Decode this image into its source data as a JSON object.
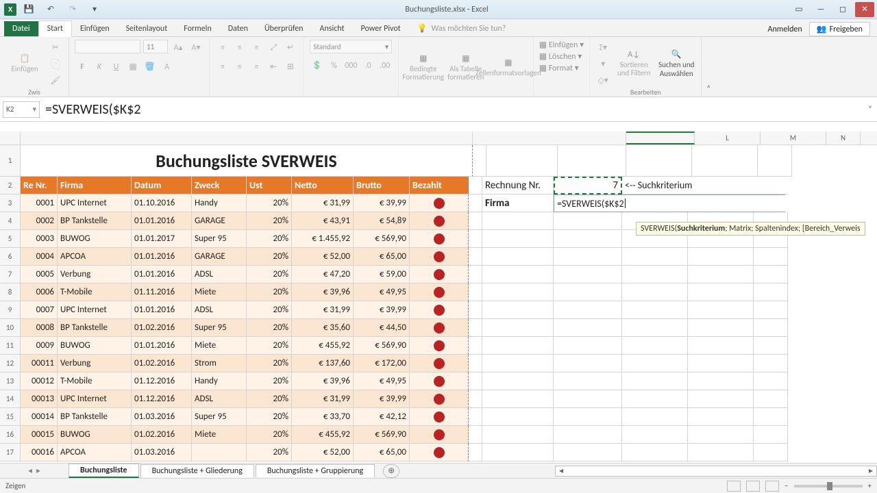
{
  "titlebar": {
    "title": "Buchungsliste.xlsx - Excel"
  },
  "tabs": {
    "file": "Datei",
    "start": "Start",
    "einfuegen": "Einfügen",
    "seitenlayout": "Seitenlayout",
    "formeln": "Formeln",
    "daten": "Daten",
    "ueberpruefen": "Überprüfen",
    "ansicht": "Ansicht",
    "powerpivot": "Power Pivot",
    "tell_me": "Was möchten Sie tun?",
    "anmelden": "Anmelden",
    "freigeben": "Freigeben"
  },
  "ribbon": {
    "paste": "Einfügen",
    "font_size": "11",
    "number_format": "Standard",
    "cond_fmt": "Bedingte Formatierung",
    "as_table": "Als Tabelle formatieren",
    "cell_styles": "Zellenformatvorlagen",
    "insert": "Einfügen",
    "delete": "Löschen",
    "format": "Format",
    "sort_filter": "Sortieren und Filtern",
    "find_select": "Suchen und Auswählen",
    "grp_clip": "Zwis",
    "grp_edit": "Bearbeiten"
  },
  "formula_bar": {
    "name_box": "K2",
    "formula": "=SVERWEIS($K$2"
  },
  "grid": {
    "title": "Buchungsliste SVERWEIS",
    "headers": {
      "a": "Re Nr.",
      "b": "Firma",
      "c": "Datum",
      "d": "Zweck",
      "e": "Ust",
      "f": "Netto",
      "g": "Brutto",
      "h": "Bezahlt"
    },
    "side": {
      "j2": "Rechnung Nr.",
      "k2": "7",
      "l2": "<-- Suchkriterium",
      "j3": "Firma",
      "k3": "=SVERWEIS($K$2"
    },
    "tooltip_prefix": "SVERWEIS(",
    "tooltip_bold": "Suchkriterium",
    "tooltip_rest": "; Matrix; Spaltenindex; [Bereich_Verweis",
    "rows": [
      {
        "n": "3",
        "a": "0001",
        "b": "UPC Internet",
        "c": "01.10.2016",
        "d": "Handy",
        "e": "20%",
        "f": "€      31,99",
        "g": "€ 39,99"
      },
      {
        "n": "4",
        "a": "0002",
        "b": "BP Tankstelle",
        "c": "01.01.2016",
        "d": "GARAGE",
        "e": "20%",
        "f": "€      43,91",
        "g": "€ 54,89"
      },
      {
        "n": "5",
        "a": "0003",
        "b": "BUWOG",
        "c": "01.01.2017",
        "d": "Super 95",
        "e": "20%",
        "f": "€ 1.455,92",
        "g": "€ 569,90"
      },
      {
        "n": "6",
        "a": "0004",
        "b": "APCOA",
        "c": "01.01.2016",
        "d": "GARAGE",
        "e": "20%",
        "f": "€      52,00",
        "g": "€ 65,00"
      },
      {
        "n": "7",
        "a": "0005",
        "b": "Verbung",
        "c": "01.01.2016",
        "d": "ADSL",
        "e": "20%",
        "f": "€      47,20",
        "g": "€ 59,00"
      },
      {
        "n": "8",
        "a": "0006",
        "b": "T-Mobile",
        "c": "01.11.2016",
        "d": "Miete",
        "e": "20%",
        "f": "€      39,96",
        "g": "€ 49,95"
      },
      {
        "n": "9",
        "a": "0007",
        "b": "UPC Internet",
        "c": "01.01.2016",
        "d": "ADSL",
        "e": "20%",
        "f": "€      31,99",
        "g": "€ 39,99"
      },
      {
        "n": "10",
        "a": "0008",
        "b": "BP Tankstelle",
        "c": "01.02.2016",
        "d": "Super 95",
        "e": "20%",
        "f": "€      35,60",
        "g": "€ 44,50"
      },
      {
        "n": "11",
        "a": "0009",
        "b": "BUWOG",
        "c": "01.01.2016",
        "d": "Miete",
        "e": "20%",
        "f": "€    455,92",
        "g": "€ 569,90"
      },
      {
        "n": "12",
        "a": "00011",
        "b": "Verbung",
        "c": "01.02.2016",
        "d": "Strom",
        "e": "20%",
        "f": "€    137,60",
        "g": "€ 172,00"
      },
      {
        "n": "13",
        "a": "00012",
        "b": "T-Mobile",
        "c": "01.12.2016",
        "d": "Handy",
        "e": "20%",
        "f": "€      39,96",
        "g": "€ 49,95"
      },
      {
        "n": "14",
        "a": "00013",
        "b": "UPC Internet",
        "c": "01.12.2016",
        "d": "ADSL",
        "e": "20%",
        "f": "€      31,99",
        "g": "€ 39,99"
      },
      {
        "n": "15",
        "a": "00014",
        "b": "BP Tankstelle",
        "c": "01.03.2016",
        "d": "Super 95",
        "e": "20%",
        "f": "€      33,70",
        "g": "€ 42,12"
      },
      {
        "n": "16",
        "a": "00015",
        "b": "BUWOG",
        "c": "01.02.2016",
        "d": "Miete",
        "e": "20%",
        "f": "€    455,92",
        "g": "€ 569,90"
      },
      {
        "n": "17",
        "a": "00016",
        "b": "APCOA",
        "c": "01.03.2016",
        "d": "",
        "e": "20%",
        "f": "€      52,00",
        "g": "€ 65,00"
      }
    ],
    "colhdrs": {
      "L": "L",
      "M": "M",
      "N": "N"
    }
  },
  "sheets": {
    "s1": "Buchungsliste",
    "s2": "Buchungsliste + Gliederung",
    "s3": "Buchungsliste + Gruppierung"
  },
  "status": {
    "mode": "Zeigen"
  }
}
